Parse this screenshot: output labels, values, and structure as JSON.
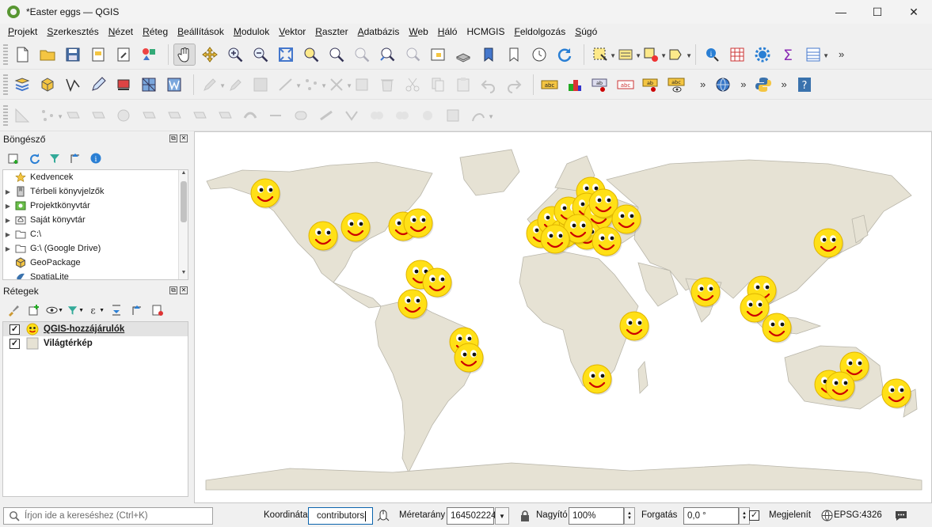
{
  "window": {
    "title": "*Easter eggs — QGIS",
    "minimize": "—",
    "maximize": "☐",
    "close": "✕"
  },
  "menubar": [
    {
      "label": "Projekt",
      "key": "P"
    },
    {
      "label": "Szerkesztés",
      "key": "S"
    },
    {
      "label": "Nézet",
      "key": "N"
    },
    {
      "label": "Réteg",
      "key": "R"
    },
    {
      "label": "Beállítások",
      "key": "B"
    },
    {
      "label": "Modulok",
      "key": "M"
    },
    {
      "label": "Vektor",
      "key": "V"
    },
    {
      "label": "Raszter",
      "key": "R"
    },
    {
      "label": "Adatbázis",
      "key": "A"
    },
    {
      "label": "Web",
      "key": "W"
    },
    {
      "label": "Háló",
      "key": "H"
    },
    {
      "label": "HCMGIS",
      "key": ""
    },
    {
      "label": "Feldolgozás",
      "key": "F"
    },
    {
      "label": "Súgó",
      "key": "S"
    }
  ],
  "browser_panel": {
    "title": "Böngésző",
    "items": [
      {
        "label": "Kedvencek",
        "icon": "star-icon",
        "expandable": false
      },
      {
        "label": "Térbeli könyvjelzők",
        "icon": "bookmark-icon",
        "expandable": true
      },
      {
        "label": "Projektkönyvtár",
        "icon": "project-folder-icon",
        "expandable": true
      },
      {
        "label": "Saját könyvtár",
        "icon": "home-folder-icon",
        "expandable": true
      },
      {
        "label": "C:\\",
        "icon": "folder-icon",
        "expandable": true
      },
      {
        "label": "G:\\ (Google Drive)",
        "icon": "folder-icon",
        "expandable": true
      },
      {
        "label": "GeoPackage",
        "icon": "geopackage-icon",
        "expandable": false
      },
      {
        "label": "SpatiaLite",
        "icon": "spatialite-icon",
        "expandable": false
      }
    ]
  },
  "layers_panel": {
    "title": "Rétegek",
    "layers": [
      {
        "name": "QGIS-hozzájárulók",
        "checked": true,
        "icon": "smiley-icon",
        "selected": true
      },
      {
        "name": "Világtérkép",
        "checked": true,
        "icon": "polygon-fill-icon",
        "selected": false
      }
    ]
  },
  "statusbar": {
    "search_placeholder": "Írjon ide a kereséshez (Ctrl+K)",
    "coordinate_label": "Koordináta",
    "coordinate_value": "contributors",
    "scale_label": "Méretarány",
    "scale_value": "164502224",
    "magnifier_label": "Nagyító",
    "magnifier_value": "100%",
    "rotation_label": "Forgatás",
    "rotation_value": "0,0 °",
    "render_label": "Megjelenít",
    "render_checked": true,
    "crs": "EPSG:4326"
  },
  "colors": {
    "land": "#e6e2d4",
    "land_stroke": "#b9b6aa",
    "smiley": "#ffe016",
    "qgis_green": "#589632",
    "accent": "#0a64ad"
  }
}
